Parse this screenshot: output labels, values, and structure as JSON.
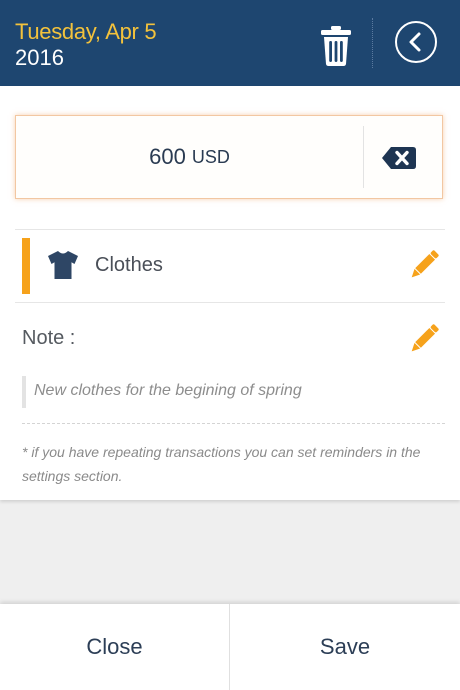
{
  "header": {
    "date_line1": "Tuesday, Apr 5",
    "date_line2": "2016",
    "accent_color": "#f3c23c",
    "background_color": "#1e4670"
  },
  "amount": {
    "value": "600",
    "currency": "USD"
  },
  "category": {
    "label": "Clothes",
    "icon": "shirt-icon",
    "accent_color": "#f6a21b"
  },
  "note": {
    "label": "Note :",
    "text": "New clothes for the begining of spring"
  },
  "hint": "* if you have repeating transactions you can set reminders in the settings section.",
  "footer": {
    "close_label": "Close",
    "save_label": "Save"
  }
}
